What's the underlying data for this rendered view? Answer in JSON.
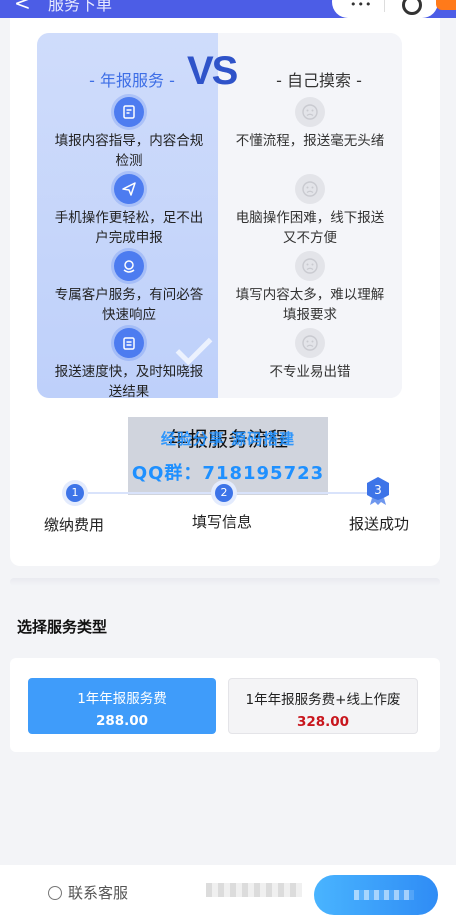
{
  "header": {
    "back_glyph": "<",
    "title": "服务下单",
    "menu_glyph": "•••"
  },
  "compare": {
    "left_heading": "- 年报服务 -",
    "vs": "VS",
    "right_heading": "- 自己摸索 -",
    "left_items": [
      {
        "icon": "document-check-icon",
        "text": "填报内容指导，内容合规检测"
      },
      {
        "icon": "paper-plane-icon",
        "text": "手机操作更轻松，足不出户完成申报"
      },
      {
        "icon": "customer-service-icon",
        "text": "专属客户服务，有问必答快速响应"
      },
      {
        "icon": "clipboard-icon",
        "text": "报送速度快，及时知晓报送结果"
      }
    ],
    "right_items": [
      {
        "icon": "sad-face-icon",
        "text": "不懂流程，报送毫无头绪"
      },
      {
        "icon": "sad-face-icon",
        "text": "电脑操作困难，线下报送又不方便"
      },
      {
        "icon": "sad-face-icon",
        "text": "填写内容太多，难以理解填报要求"
      },
      {
        "icon": "sad-face-icon",
        "text": "不专业易出错"
      }
    ]
  },
  "process": {
    "title": "年报服务流程",
    "steps": [
      {
        "num": "1",
        "label": "缴纳费用"
      },
      {
        "num": "2",
        "label": "填写信息"
      },
      {
        "num": "3",
        "label": "报送成功"
      }
    ]
  },
  "watermark": {
    "line1": "经验分享 源码搭建",
    "line2": "QQ群：718195723"
  },
  "service": {
    "title": "选择服务类型",
    "options": [
      {
        "name": "1年年报服务费",
        "price": "288.00",
        "selected": true
      },
      {
        "name": "1年年报服务费+线上作废",
        "price": "328.00",
        "selected": false
      }
    ]
  },
  "footer": {
    "contact_label": "联系客服"
  },
  "colors": {
    "brand_blue": "#3f9cfa",
    "header_blue": "#4c5de6",
    "price_red": "#c8161d",
    "step_blue": "#3d74e8"
  }
}
